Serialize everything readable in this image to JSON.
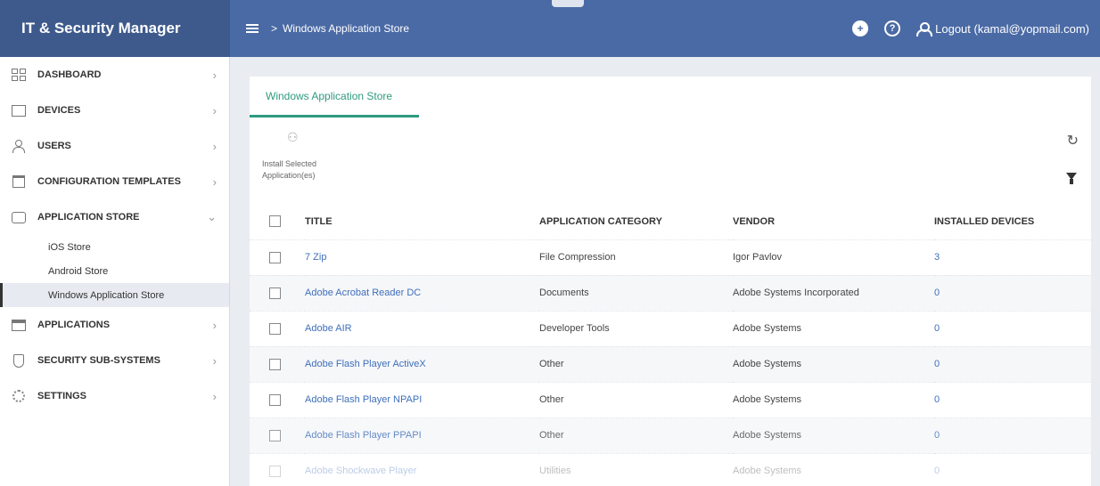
{
  "brand": {
    "title": "IT & Security Manager"
  },
  "topbar": {
    "breadcrumb_sep": ">",
    "breadcrumb": "Windows Application Store",
    "logout_label": "Logout (kamal@yopmail.com)",
    "add_icon": "add-circle-icon",
    "help_icon": "help-circle-icon"
  },
  "sidebar": {
    "items": [
      {
        "label": "DASHBOARD",
        "icon": "dashboard-icon"
      },
      {
        "label": "DEVICES",
        "icon": "devices-icon"
      },
      {
        "label": "USERS",
        "icon": "users-icon"
      },
      {
        "label": "CONFIGURATION TEMPLATES",
        "icon": "templates-icon"
      },
      {
        "label": "APPLICATION STORE",
        "icon": "store-icon"
      },
      {
        "label": "APPLICATIONS",
        "icon": "applications-icon"
      },
      {
        "label": "SECURITY SUB-SYSTEMS",
        "icon": "shield-icon"
      },
      {
        "label": "SETTINGS",
        "icon": "gear-icon"
      }
    ],
    "store_sub": [
      {
        "label": "iOS Store"
      },
      {
        "label": "Android Store"
      },
      {
        "label": "Windows Application Store"
      }
    ]
  },
  "main": {
    "tab": "Windows Application Store",
    "install_label": "Install Selected\nApplication(es)",
    "columns": [
      "TITLE",
      "APPLICATION CATEGORY",
      "VENDOR",
      "INSTALLED DEVICES"
    ],
    "rows": [
      {
        "title": "7 Zip",
        "category": "File Compression",
        "vendor": "Igor Pavlov",
        "installed": "3"
      },
      {
        "title": "Adobe Acrobat Reader DC",
        "category": "Documents",
        "vendor": "Adobe Systems Incorporated",
        "installed": "0"
      },
      {
        "title": "Adobe AIR",
        "category": "Developer Tools",
        "vendor": "Adobe Systems",
        "installed": "0"
      },
      {
        "title": "Adobe Flash Player ActiveX",
        "category": "Other",
        "vendor": "Adobe Systems",
        "installed": "0"
      },
      {
        "title": "Adobe Flash Player NPAPI",
        "category": "Other",
        "vendor": "Adobe Systems",
        "installed": "0"
      },
      {
        "title": "Adobe Flash Player PPAPI",
        "category": "Other",
        "vendor": "Adobe Systems",
        "installed": "0"
      },
      {
        "title": "Adobe Shockwave Player",
        "category": "Utilities",
        "vendor": "Adobe Systems",
        "installed": "0"
      }
    ]
  },
  "colors": {
    "brand_bg": "#3e5a8c",
    "topbar_bg": "#4a6aa5",
    "accent_green": "#2e9a7d",
    "link_blue": "#3f6fba"
  }
}
